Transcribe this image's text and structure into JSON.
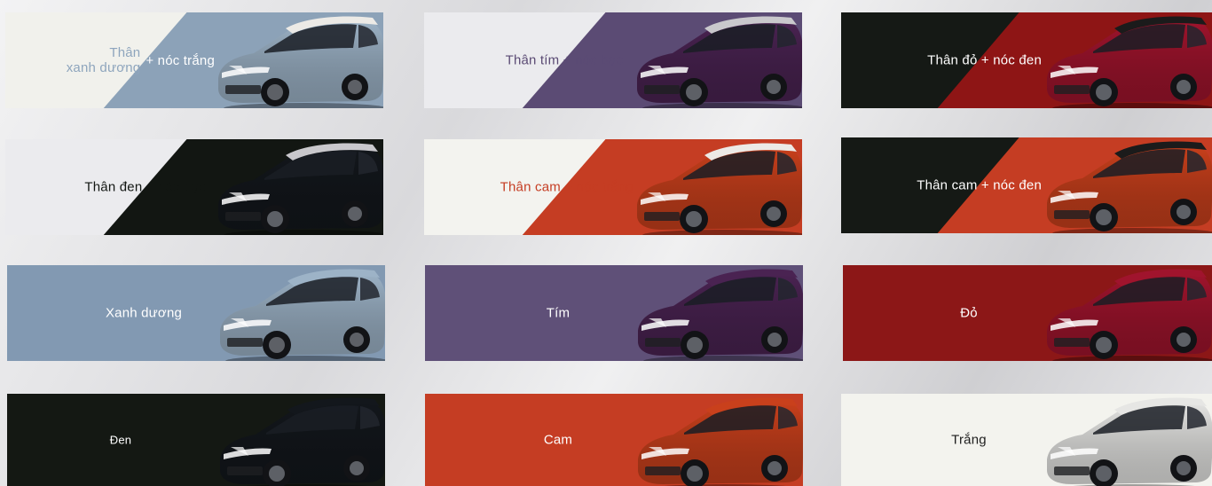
{
  "swatches": [
    {
      "id": "two-tone-blue-white",
      "label": "Thân\nxanh dương + nóc trắng",
      "label_parts": [
        "Thân",
        "xanh dương",
        "+ nóc trắng"
      ],
      "two_tone": true,
      "left": "#f1f1ec",
      "right": "#8ca2b8",
      "text": "#8ea5bd",
      "body": "#9db3c7",
      "roof": "#eceae6"
    },
    {
      "id": "two-tone-purple-silver",
      "label": "Thân tím + nóc bạc",
      "two_tone": true,
      "left": "#ebebee",
      "right": "#5b4b74",
      "text": "#5b4b74",
      "body": "#4a2352",
      "roof": "#c9c8cc"
    },
    {
      "id": "two-tone-red-black",
      "label": "Thân đỏ + nóc đen",
      "two_tone": true,
      "left": "#151915",
      "right": "#8e1515",
      "text": "#ffffff",
      "body": "#a0142d",
      "roof": "#1b1b1b"
    },
    {
      "id": "two-tone-black-silver",
      "label": "Thân đen + nóc bạc",
      "two_tone": true,
      "left": "#ebebee",
      "right": "#121612",
      "text": "#121612",
      "body": "#13171c",
      "roof": "#c9c8cc"
    },
    {
      "id": "two-tone-orange-white",
      "label": "Thân cam + nóc trắng",
      "two_tone": true,
      "left": "#f3f3ef",
      "right": "#c53d23",
      "text": "#c53d23",
      "body": "#c9401c",
      "roof": "#eceae6"
    },
    {
      "id": "two-tone-orange-black",
      "label": "Thân cam + nóc đen",
      "two_tone": true,
      "left": "#151915",
      "right": "#c53d23",
      "text": "#ffffff",
      "body": "#c9401c",
      "roof": "#1b1b1b"
    },
    {
      "id": "mono-blue",
      "label": "Xanh dương",
      "two_tone": false,
      "left": "#8299b2",
      "right": "#8299b2",
      "text": "#ffffff",
      "body": "#9db3c7",
      "roof": "#9db3c7"
    },
    {
      "id": "mono-purple",
      "label": "Tím",
      "two_tone": false,
      "left": "#5f5078",
      "right": "#5f5078",
      "text": "#ffffff",
      "body": "#4a2352",
      "roof": "#4a2352"
    },
    {
      "id": "mono-red",
      "label": "Đỏ",
      "two_tone": false,
      "left": "#8c1717",
      "right": "#8c1717",
      "text": "#ffffff",
      "body": "#a0142d",
      "roof": "#a0142d"
    },
    {
      "id": "mono-black",
      "label": "Đen",
      "two_tone": false,
      "left": "#141813",
      "right": "#141813",
      "text": "#ffffff",
      "body": "#13171c",
      "roof": "#13171c"
    },
    {
      "id": "mono-orange",
      "label": "Cam",
      "two_tone": false,
      "left": "#c53d23",
      "right": "#c53d23",
      "text": "#ffffff",
      "body": "#c9401c",
      "roof": "#c9401c"
    },
    {
      "id": "mono-white",
      "label": "Trắng",
      "two_tone": false,
      "left": "#f3f3ee",
      "right": "#f3f3ee",
      "text": "#1e1e1e",
      "body": "#e6e6e4",
      "roof": "#e6e6e4"
    }
  ]
}
